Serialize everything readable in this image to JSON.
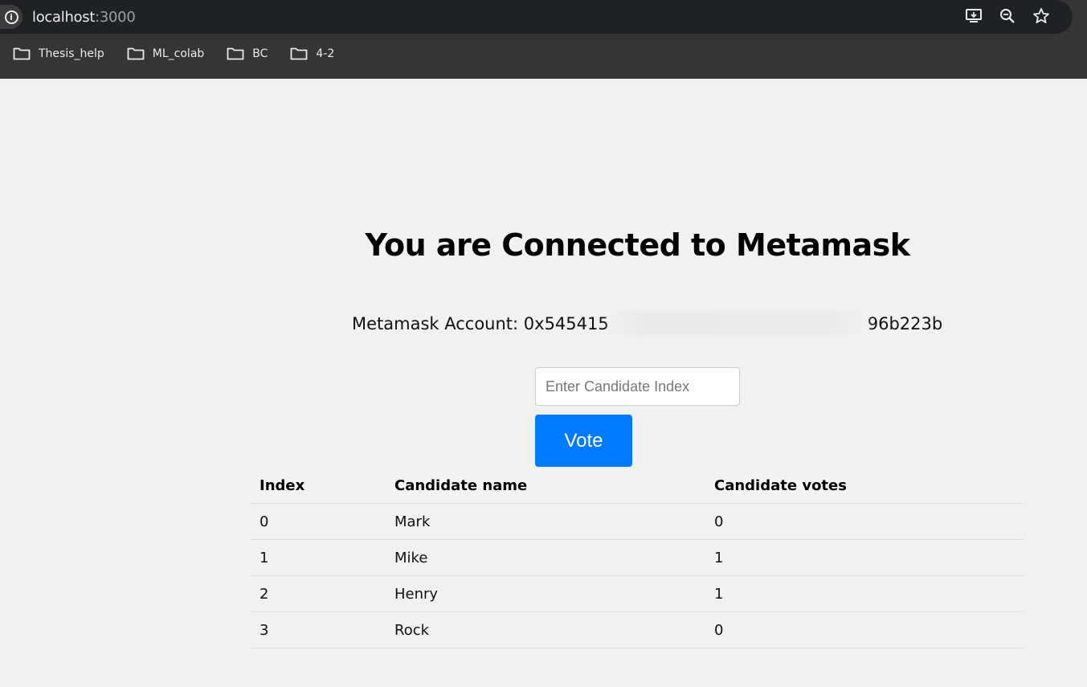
{
  "browser": {
    "url_host": "localhost",
    "url_port": ":3000",
    "bookmarks": [
      {
        "label": "Thesis_help"
      },
      {
        "label": "ML_colab"
      },
      {
        "label": "BC"
      },
      {
        "label": "4-2"
      }
    ]
  },
  "page": {
    "heading": "You are Connected to Metamask",
    "account_label": "Metamask Account: 0x545415",
    "account_suffix": "96b223b",
    "input_placeholder": "Enter Candidate Index",
    "vote_label": "Vote",
    "table": {
      "headers": [
        "Index",
        "Candidate name",
        "Candidate votes"
      ],
      "rows": [
        [
          "0",
          "Mark",
          "0"
        ],
        [
          "1",
          "Mike",
          "1"
        ],
        [
          "2",
          "Henry",
          "1"
        ],
        [
          "3",
          "Rock",
          "0"
        ]
      ]
    }
  },
  "colors": {
    "button": "#007bff",
    "page_bg": "#f1f1f1",
    "chrome_bg": "#353535"
  }
}
